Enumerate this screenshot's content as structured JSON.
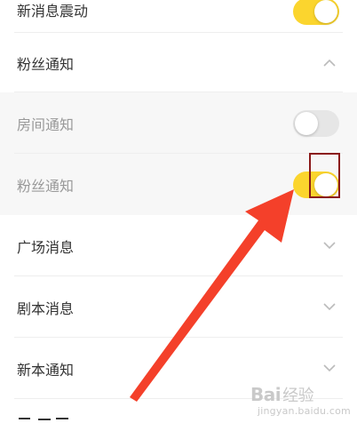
{
  "settings": {
    "new_message_vibration": {
      "label": "新消息震动",
      "enabled": true
    },
    "fan_notification_group": {
      "label": "粉丝通知",
      "expanded": true,
      "chevron": "chevron-up-icon",
      "items": [
        {
          "label": "房间通知",
          "enabled": false
        },
        {
          "label": "粉丝通知",
          "enabled": true
        }
      ]
    },
    "square_messages": {
      "label": "广场消息",
      "chevron": "chevron-down-icon"
    },
    "script_messages": {
      "label": "剧本消息",
      "chevron": "chevron-down-icon"
    },
    "new_script_notification": {
      "label": "新本通知",
      "chevron": "chevron-down-icon"
    }
  },
  "annotation": {
    "arrow_color": "#f4402a",
    "box_color": "#8b1a1a"
  },
  "colors": {
    "toggle_on": "#fbd52e",
    "toggle_off": "#e6e6e6",
    "primary_text": "#333333",
    "secondary_text": "#999999",
    "group_background": "#f7f7f7"
  },
  "watermark": {
    "brand_prefix": "Bai",
    "brand_suffix": "经验",
    "url": "jingyan.baidu.com"
  }
}
